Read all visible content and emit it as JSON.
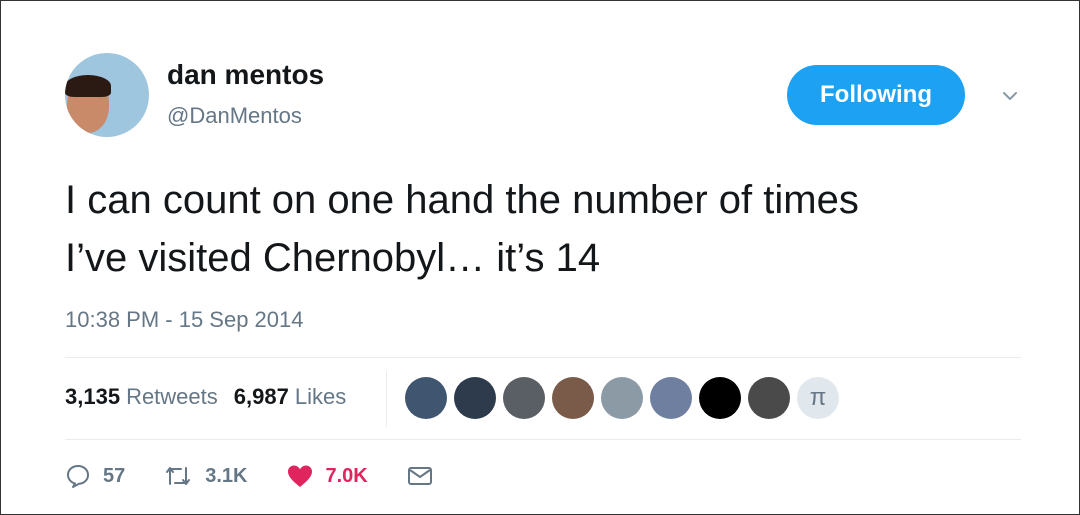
{
  "tweet": {
    "display_name": "dan mentos",
    "handle": "@DanMentos",
    "follow_label": "Following",
    "text": "I can count on one hand the number of times\nI’ve visited Chernobyl… it’s 14",
    "timestamp": "10:38 PM - 15 Sep 2014"
  },
  "stats": {
    "retweets_count": "3,135",
    "retweets_label": "Retweets",
    "likes_count": "6,987",
    "likes_label": "Likes"
  },
  "likers": {
    "colors": [
      "#3f5570",
      "#2d3b4d",
      "#5a5f66",
      "#7a5a48",
      "#8c9aa6",
      "#6f7fa0",
      "#000000",
      "#4a4a4a"
    ],
    "last_symbol": "π"
  },
  "actions": {
    "reply_count": "57",
    "retweet_count": "3.1K",
    "like_count": "7.0K"
  },
  "colors": {
    "accent": "#1da1f2",
    "like": "#e0245e",
    "secondary_text": "#657786"
  }
}
